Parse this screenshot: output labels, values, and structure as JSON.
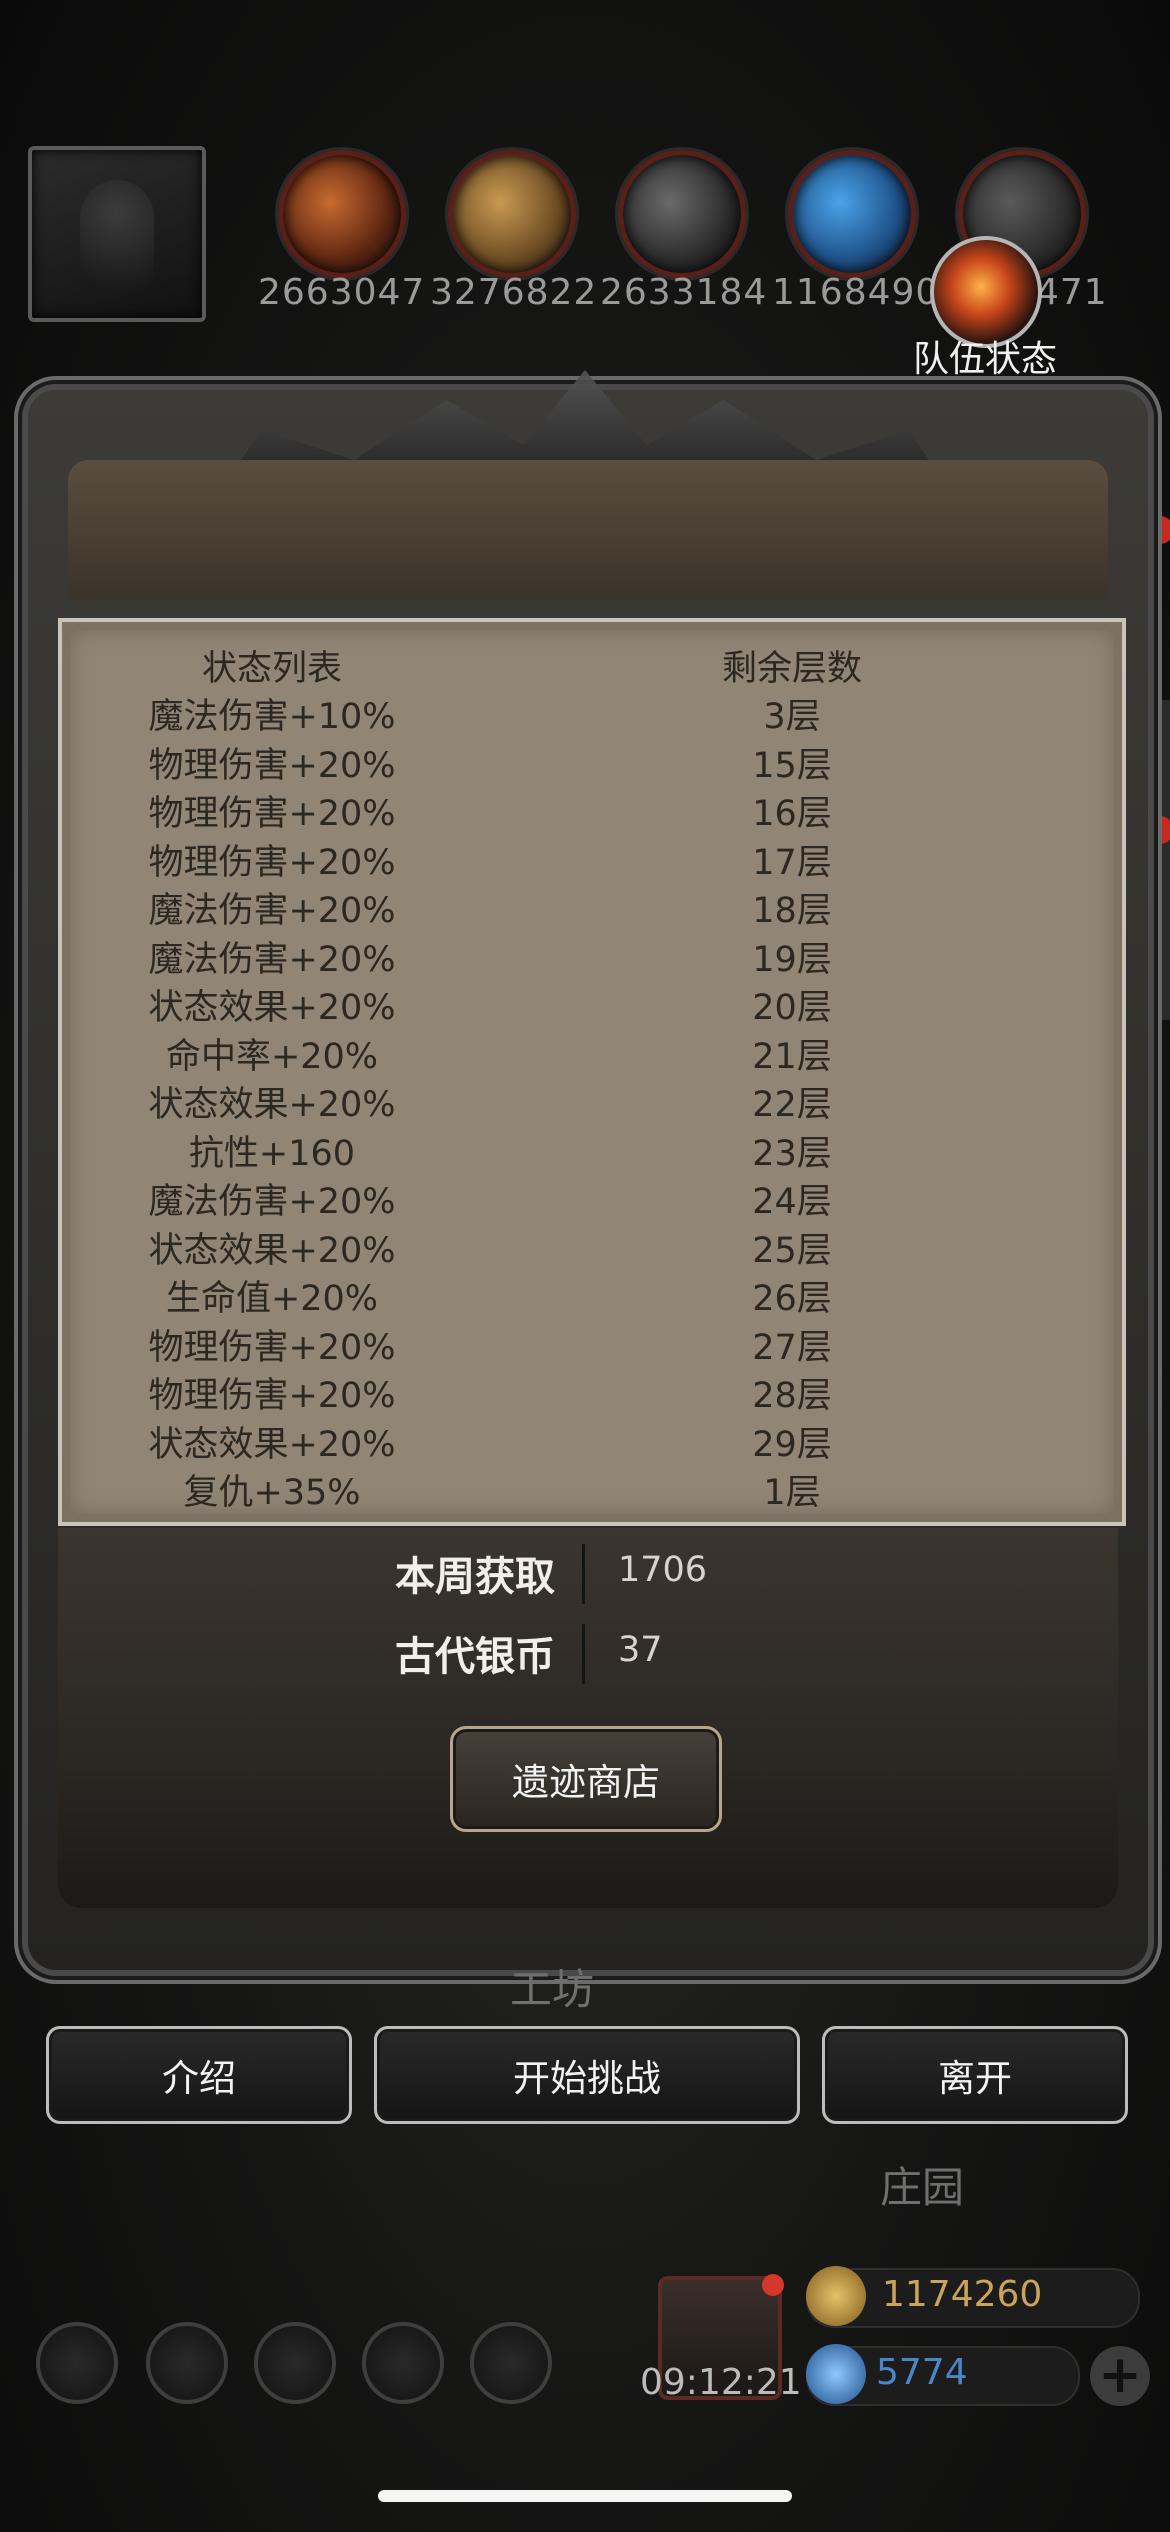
{
  "resources": [
    {
      "icon": "meat-icon",
      "value": "2663047"
    },
    {
      "icon": "wood-icon",
      "value": "3276822"
    },
    {
      "icon": "iron-icon",
      "value": "2633184"
    },
    {
      "icon": "crystal-icon",
      "value": "1168490"
    },
    {
      "icon": "stone-icon",
      "value": "471"
    }
  ],
  "team_status": {
    "label": "队伍状态",
    "icon": "flame-icon"
  },
  "status_list": {
    "header": {
      "name": "状态列表",
      "layers": "剩余层数"
    },
    "rows": [
      {
        "name": "魔法伤害+10%",
        "layers": "3层"
      },
      {
        "name": "物理伤害+20%",
        "layers": "15层"
      },
      {
        "name": "物理伤害+20%",
        "layers": "16层"
      },
      {
        "name": "物理伤害+20%",
        "layers": "17层"
      },
      {
        "name": "魔法伤害+20%",
        "layers": "18层"
      },
      {
        "name": "魔法伤害+20%",
        "layers": "19层"
      },
      {
        "name": "状态效果+20%",
        "layers": "20层"
      },
      {
        "name": "命中率+20%",
        "layers": "21层"
      },
      {
        "name": "状态效果+20%",
        "layers": "22层"
      },
      {
        "name": "抗性+160",
        "layers": "23层"
      },
      {
        "name": "魔法伤害+20%",
        "layers": "24层"
      },
      {
        "name": "状态效果+20%",
        "layers": "25层"
      },
      {
        "name": "生命值+20%",
        "layers": "26层"
      },
      {
        "name": "物理伤害+20%",
        "layers": "27层"
      },
      {
        "name": "物理伤害+20%",
        "layers": "28层"
      },
      {
        "name": "状态效果+20%",
        "layers": "29层"
      },
      {
        "name": "复仇+35%",
        "layers": "1层"
      }
    ]
  },
  "info": {
    "weekly_label": "本周获取",
    "weekly_value": "1706",
    "coin_label": "古代银币",
    "coin_value": "37"
  },
  "shop_button": "遗迹商店",
  "buttons": {
    "intro": "介绍",
    "start": "开始挑战",
    "leave": "离开"
  },
  "background_labels": {
    "workshop": "工坊",
    "manor": "庄园"
  },
  "bottom_bar": {
    "timer": "09:12:21",
    "gold": "1174260",
    "gems": "5774",
    "colors": {
      "gold": "#c9a45a",
      "gems": "#4b86c9"
    }
  }
}
